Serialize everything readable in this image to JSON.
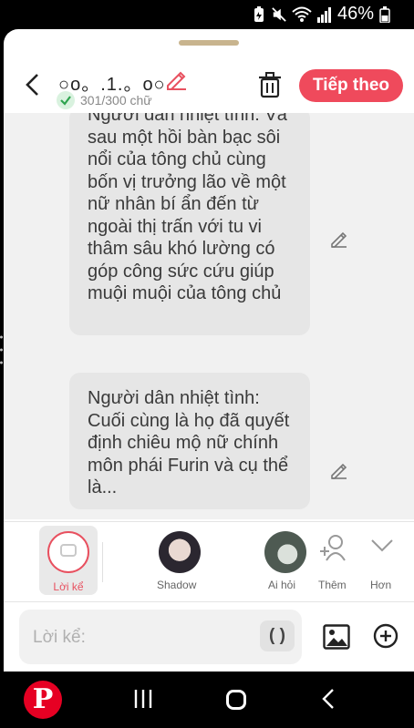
{
  "status": {
    "battery": "46%"
  },
  "header": {
    "title": "○o。.1.。o○",
    "counter": "301/300 chữ",
    "next_label": "Tiếp theo"
  },
  "messages": [
    {
      "text": "Người dân nhiệt tình: Và sau một hồi bàn bạc sôi nổi của tông chủ cùng bốn vị trưởng lão về một nữ nhân bí ẩn đến từ ngoài thị trấn với tu vi thâm sâu khó lường có góp công sức cứu giúp muội muội của tông chủ"
    },
    {
      "text": "Người dân nhiệt tình: Cuối cùng là họ đã quyết định chiêu mộ nữ chính môn phái Furin và cụ thể là..."
    }
  ],
  "toolbar": {
    "narrator_label": "Lời kể",
    "characters": [
      {
        "name": "Shadow"
      },
      {
        "name": "Ai hỏi"
      }
    ],
    "add_label": "Thêm",
    "more_label": "Hơn"
  },
  "input": {
    "placeholder": "Lời kể:",
    "paren_label": "( )"
  },
  "colors": {
    "accent": "#ef4a5c",
    "pinterest": "#e60023",
    "handle": "#c8b48e"
  }
}
